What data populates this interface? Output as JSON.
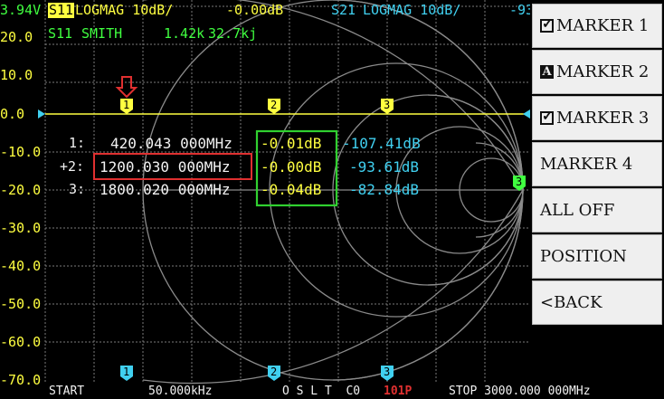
{
  "device": {
    "battery": "3.94V"
  },
  "header": {
    "trace1_name": "S11",
    "trace1_format": "LOGMAG 10dB/",
    "trace1_value": "-0.00dB",
    "trace2_name": "S11",
    "trace2_format": "SMITH",
    "trace2_r": "1.42k",
    "trace2_x": "32.7kj",
    "trace3_name": "S21",
    "trace3_format": "LOGMAG 10dB/",
    "trace3_value": "-93"
  },
  "y_axis": {
    "labels": [
      "20.0",
      "10.0",
      "0.0",
      "-10.0",
      "-20.0",
      "-30.0",
      "-40.0",
      "-50.0",
      "-60.0",
      "-70.0"
    ]
  },
  "markers": [
    {
      "id": "1",
      "label": "1:",
      "freq": "420.043 000MHz",
      "s11": "-0.01dB",
      "s21": "-107.41dB"
    },
    {
      "id": "2",
      "label": "+2:",
      "freq": "1200.030 000MHz",
      "s11": "-0.00dB",
      "s21": "-93.61dB"
    },
    {
      "id": "3",
      "label": "3:",
      "freq": "1800.020 000MHz",
      "s11": "-0.04dB",
      "s21": "-82.84dB"
    }
  ],
  "marker_tags": {
    "m1": "1",
    "m2": "2",
    "m3": "3",
    "smith_marker": "3"
  },
  "menu": {
    "items": [
      {
        "label": "MARKER 1",
        "check": "on"
      },
      {
        "label": "MARKER 2",
        "check": "active",
        "check_glyph": "A"
      },
      {
        "label": "MARKER 3",
        "check": "on"
      },
      {
        "label": "MARKER 4",
        "check": "none"
      },
      {
        "label": "ALL OFF",
        "check": "none"
      },
      {
        "label": "POSITION",
        "check": "none"
      },
      {
        "label": "<BACK",
        "check": "none"
      }
    ]
  },
  "footer": {
    "start_label": "START",
    "start_value": "50.000kHz",
    "cal": "O S L T  C0",
    "points": "101P",
    "stop": "STOP 3000.000 000MHz"
  },
  "colors": {
    "trace_s11": "#ffff40",
    "trace_s21": "#40d0f0",
    "smith_trace": "#40ff40",
    "grid": "#808080",
    "highlight_red": "#e03030",
    "highlight_green": "#30d030"
  }
}
